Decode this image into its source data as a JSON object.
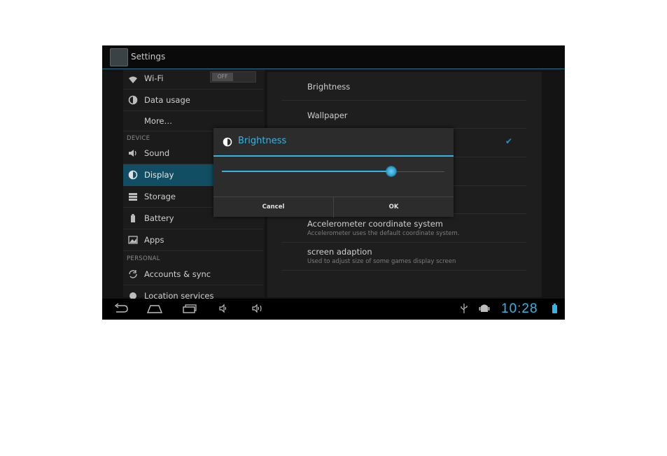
{
  "action_bar": {
    "title": "Settings"
  },
  "sidebar": {
    "items": [
      {
        "label": "Wi-Fi",
        "icon": "wifi-icon",
        "toggle": "OFF"
      },
      {
        "label": "Data usage",
        "icon": "data-usage-icon"
      },
      {
        "label": "More…",
        "icon": ""
      },
      {
        "label": "Sound",
        "icon": "sound-icon"
      },
      {
        "label": "Display",
        "icon": "display-icon",
        "selected": true
      },
      {
        "label": "Storage",
        "icon": "storage-icon"
      },
      {
        "label": "Battery",
        "icon": "battery-icon"
      },
      {
        "label": "Apps",
        "icon": "apps-icon"
      },
      {
        "label": "Accounts & sync",
        "icon": "sync-icon"
      },
      {
        "label": "Location services",
        "icon": "location-icon"
      }
    ],
    "sections": {
      "device": "DEVICE",
      "personal": "PERSONAL"
    }
  },
  "display_settings": {
    "items": [
      {
        "title": "Brightness"
      },
      {
        "title": "Wallpaper"
      },
      {
        "title": "Accelerometer coordinate system",
        "subtitle": "Accelerometer uses the default coordinate system."
      },
      {
        "title": "screen adaption",
        "subtitle": "Used to adjust size of some games display screen"
      }
    ]
  },
  "dialog": {
    "title": "Brightness",
    "brightness_level": 0.76,
    "cancel_label": "Cancel",
    "ok_label": "OK"
  },
  "status": {
    "time": "10:28"
  },
  "colors": {
    "accent": "#33b5e5",
    "selected": "#124e63"
  }
}
